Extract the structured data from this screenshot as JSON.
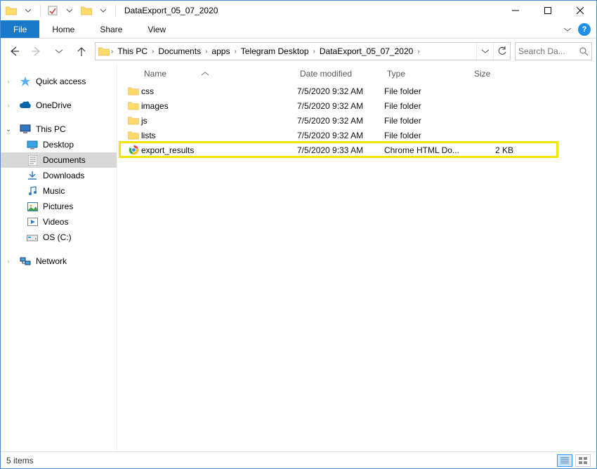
{
  "title": "DataExport_05_07_2020",
  "ribbon": {
    "file": "File",
    "tabs": [
      "Home",
      "Share",
      "View"
    ]
  },
  "breadcrumbs": [
    "This PC",
    "Documents",
    "apps",
    "Telegram Desktop",
    "DataExport_05_07_2020"
  ],
  "search_placeholder": "Search Da...",
  "nav": {
    "quick_access": "Quick access",
    "onedrive": "OneDrive",
    "this_pc": "This PC",
    "desktop": "Desktop",
    "documents": "Documents",
    "downloads": "Downloads",
    "music": "Music",
    "pictures": "Pictures",
    "videos": "Videos",
    "os_c": "OS (C:)",
    "network": "Network"
  },
  "columns": {
    "name": "Name",
    "date": "Date modified",
    "type": "Type",
    "size": "Size"
  },
  "items": [
    {
      "name": "css",
      "date": "7/5/2020 9:32 AM",
      "type": "File folder",
      "size": "",
      "icon": "folder"
    },
    {
      "name": "images",
      "date": "7/5/2020 9:32 AM",
      "type": "File folder",
      "size": "",
      "icon": "folder"
    },
    {
      "name": "js",
      "date": "7/5/2020 9:32 AM",
      "type": "File folder",
      "size": "",
      "icon": "folder"
    },
    {
      "name": "lists",
      "date": "7/5/2020 9:32 AM",
      "type": "File folder",
      "size": "",
      "icon": "folder"
    },
    {
      "name": "export_results",
      "date": "7/5/2020 9:33 AM",
      "type": "Chrome HTML Do...",
      "size": "2 KB",
      "icon": "chrome"
    }
  ],
  "highlighted_index": 4,
  "status": "5 items"
}
